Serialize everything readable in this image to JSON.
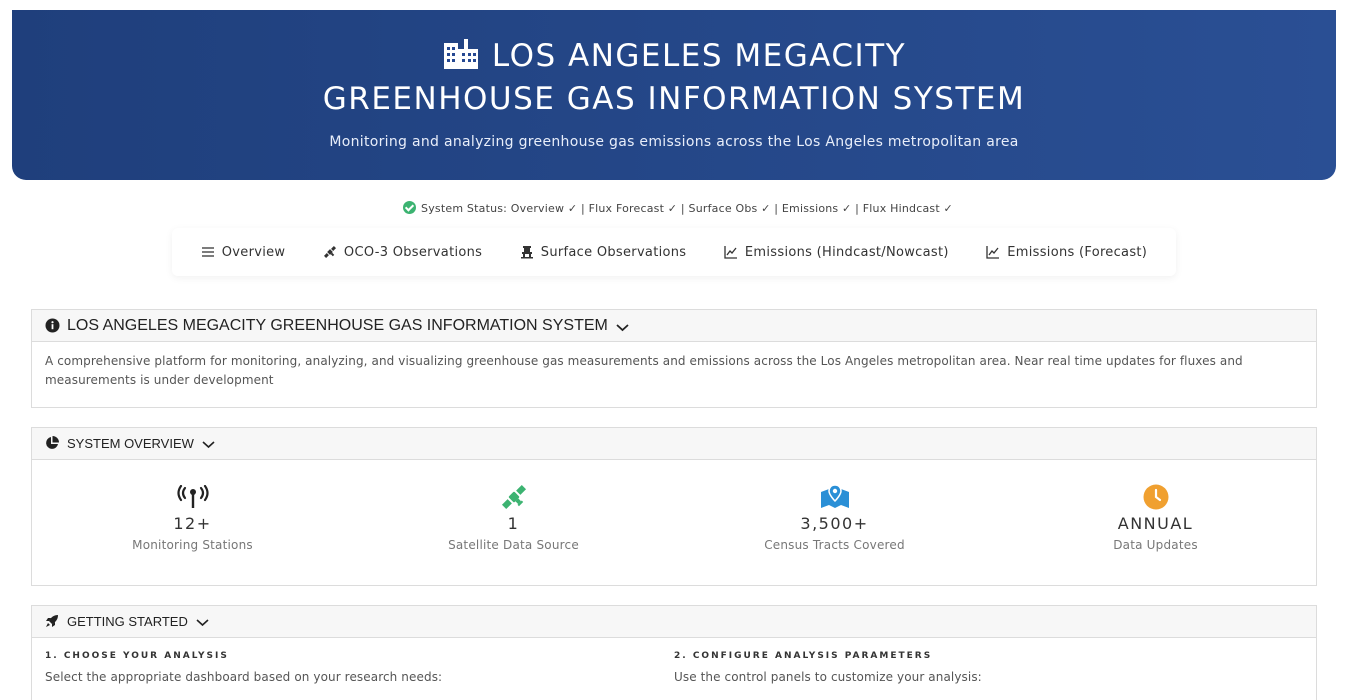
{
  "header": {
    "title_line1": "LOS ANGELES MEGACITY",
    "title_line2": "GREENHOUSE GAS INFORMATION SYSTEM",
    "subtitle": "Monitoring and analyzing greenhouse gas emissions across the Los Angeles metropolitan area",
    "icon": "building-icon"
  },
  "status": {
    "text": "System Status: Overview ✓ | Flux Forecast ✓ | Surface Obs ✓ | Emissions ✓ | Flux Hindcast ✓",
    "color": "#3cb371"
  },
  "nav": {
    "items": [
      {
        "label": "Overview",
        "icon": "menu-icon"
      },
      {
        "label": "OCO-3 Observations",
        "icon": "satellite-icon"
      },
      {
        "label": "Surface Observations",
        "icon": "tower-icon"
      },
      {
        "label": "Emissions (Hindcast/Nowcast)",
        "icon": "line-chart-icon"
      },
      {
        "label": "Emissions (Forecast)",
        "icon": "line-chart-icon"
      }
    ]
  },
  "about": {
    "title": "LOS ANGELES MEGACITY GREENHOUSE GAS INFORMATION SYSTEM",
    "body": "A comprehensive platform for monitoring, analyzing, and visualizing greenhouse gas measurements and emissions across the Los Angeles metropolitan area. Near real time updates for fluxes and measurements is under development"
  },
  "overview": {
    "title": "SYSTEM OVERVIEW",
    "stats": [
      {
        "value": "12+",
        "label": "Monitoring Stations",
        "icon": "broadcast-tower-icon",
        "color": "#222222"
      },
      {
        "value": "1",
        "label": "Satellite Data Source",
        "icon": "satellite-icon",
        "color": "#3cb371"
      },
      {
        "value": "3,500+",
        "label": "Census Tracts Covered",
        "icon": "map-marked-icon",
        "color": "#2a8fd6"
      },
      {
        "value": "ANNUAL",
        "label": "Data Updates",
        "icon": "clock-icon",
        "color": "#f0a030"
      }
    ]
  },
  "getting_started": {
    "title": "GETTING STARTED",
    "steps": [
      {
        "title": "1. CHOOSE YOUR ANALYSIS",
        "desc": "Select the appropriate dashboard based on your research needs:"
      },
      {
        "title": "2. CONFIGURE ANALYSIS PARAMETERS",
        "desc": "Use the control panels to customize your analysis:"
      }
    ]
  },
  "colors": {
    "header_bg": "#2a4f94",
    "accent_green": "#3cb371",
    "accent_blue": "#2a8fd6",
    "accent_orange": "#f0a030"
  }
}
